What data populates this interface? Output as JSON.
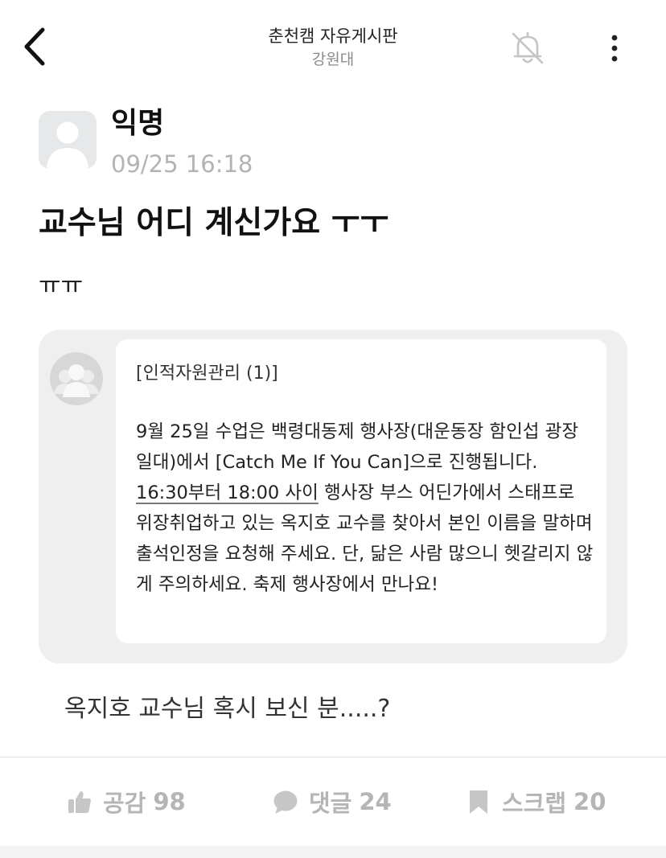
{
  "header": {
    "board_title": "춘천캠 자유게시판",
    "school_name": "강원대",
    "icons": {
      "back": "back-arrow-icon",
      "bell": "bell-off-icon",
      "more": "more-vertical-icon"
    }
  },
  "post": {
    "author": "익명",
    "date": "09/25 16:18",
    "title": "교수님 어디 계신가요 ㅜㅜ",
    "body": "ㅠㅠ",
    "caption": "옥지호 교수님 혹시 보신 분.....?"
  },
  "attachment": {
    "header": "[인적자원관리 (1)]",
    "text_before": "9월 25일 수업은 백령대동제 행사장(대운동장 함인섭 광장일대)에서 [Catch Me If You Can]으로 진행됩니다. ",
    "text_underlined": "16:30부터 18:00 사이",
    "text_after": " 행사장 부스 어딘가에서 스태프로 위장취업하고 있는 옥지호 교수를 찾아서 본인 이름을 말하며 출석인정을 요청해 주세요. 단, 닮은 사람 많으니 헷갈리지 않게 주의하세요. 축제 행사장에서 만나요!"
  },
  "actions": {
    "like": {
      "label": "공감",
      "count": "98",
      "icon": "thumbs-up-icon"
    },
    "comment": {
      "label": "댓글",
      "count": "24",
      "icon": "speech-bubble-icon"
    },
    "scrap": {
      "label": "스크랩",
      "count": "20",
      "icon": "bookmark-icon"
    }
  },
  "colors": {
    "muted_text": "#b5b5b5",
    "card_background": "#efefef",
    "avatar_background": "#e6e8ea"
  }
}
